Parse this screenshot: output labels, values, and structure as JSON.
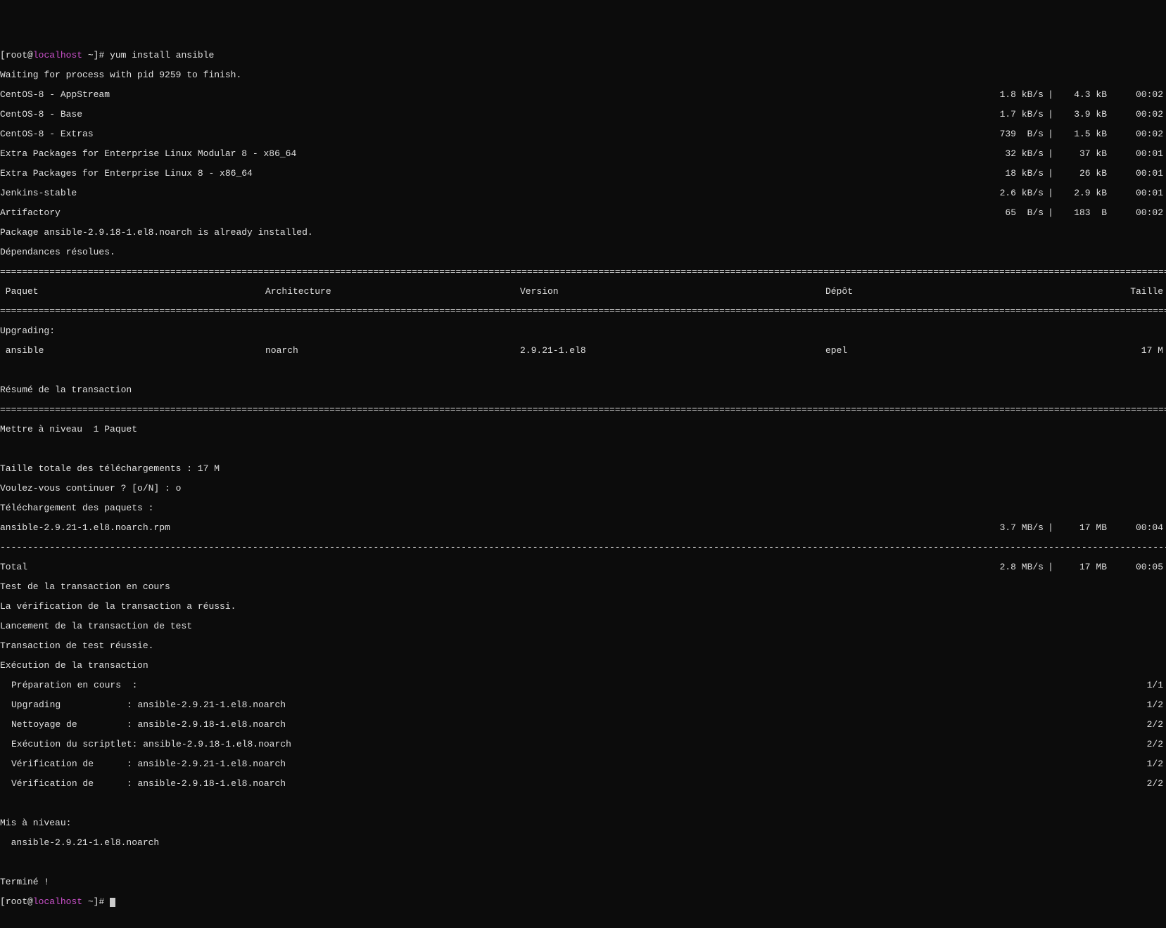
{
  "prompt": {
    "user": "root",
    "at": "@",
    "host": "localhost",
    "path": " ~",
    "suffix": "]# "
  },
  "command": "yum install ansible",
  "waiting": "Waiting for process with pid 9259 to finish.",
  "repos": [
    {
      "name": "CentOS-8 - AppStream",
      "speed": "1.8 kB/s",
      "size": "4.3 kB",
      "time": "00:02"
    },
    {
      "name": "CentOS-8 - Base",
      "speed": "1.7 kB/s",
      "size": "3.9 kB",
      "time": "00:02"
    },
    {
      "name": "CentOS-8 - Extras",
      "speed": "739  B/s",
      "size": "1.5 kB",
      "time": "00:02"
    },
    {
      "name": "Extra Packages for Enterprise Linux Modular 8 - x86_64",
      "speed": "32 kB/s",
      "size": "37 kB",
      "time": "00:01"
    },
    {
      "name": "Extra Packages for Enterprise Linux 8 - x86_64",
      "speed": "18 kB/s",
      "size": "26 kB",
      "time": "00:01"
    },
    {
      "name": "Jenkins-stable",
      "speed": "2.6 kB/s",
      "size": "2.9 kB",
      "time": "00:01"
    },
    {
      "name": "Artifactory",
      "speed": "65  B/s",
      "size": "183  B",
      "time": "00:02"
    }
  ],
  "already_installed": "Package ansible-2.9.18-1.el8.noarch is already installed.",
  "deps_resolved": "Dépendances résolues.",
  "headers": {
    "paquet": " Paquet",
    "arch": "Architecture",
    "version": "Version",
    "depot": "Dépôt",
    "taille": "Taille"
  },
  "upgrading_label": "Upgrading:",
  "package": {
    "name": " ansible",
    "arch": "noarch",
    "version": "2.9.21-1.el8",
    "depot": "epel",
    "taille": "17 M"
  },
  "summary_title": "Résumé de la transaction",
  "upgrade_count": "Mettre à niveau  1 Paquet",
  "total_dl": "Taille totale des téléchargements : 17 M",
  "continue_prompt": "Voulez-vous continuer ? [o/N] : o",
  "dl_label": "Téléchargement des paquets :",
  "dl_pkg": {
    "name": "ansible-2.9.21-1.el8.noarch.rpm",
    "speed": "3.7 MB/s",
    "size": "17 MB",
    "time": "00:04"
  },
  "total_line": {
    "label": "Total",
    "speed": "2.8 MB/s",
    "size": "17 MB",
    "time": "00:05"
  },
  "trans": {
    "test_running": "Test de la transaction en cours",
    "verify_ok": "La vérification de la transaction a réussi.",
    "launch_test": "Lancement de la transaction de test",
    "test_ok": "Transaction de test réussie.",
    "exec": "Exécution de la transaction"
  },
  "steps": [
    {
      "label": "Préparation en cours  :",
      "pkg": "",
      "prog": "1/1"
    },
    {
      "label": "Upgrading            :",
      "pkg": " ansible-2.9.21-1.el8.noarch",
      "prog": "1/2"
    },
    {
      "label": "Nettoyage de         :",
      "pkg": " ansible-2.9.18-1.el8.noarch",
      "prog": "2/2"
    },
    {
      "label": "Exécution du scriptlet:",
      "pkg": " ansible-2.9.18-1.el8.noarch",
      "prog": "2/2"
    },
    {
      "label": "Vérification de      :",
      "pkg": " ansible-2.9.21-1.el8.noarch",
      "prog": "1/2"
    },
    {
      "label": "Vérification de      :",
      "pkg": " ansible-2.9.18-1.el8.noarch",
      "prog": "2/2"
    }
  ],
  "upgraded_label": "Mis à niveau:",
  "upgraded_pkg": "  ansible-2.9.21-1.el8.noarch",
  "done": "Terminé !",
  "rule_eq": "======================================================================================================================================================================================================================================",
  "rule_dash": "--------------------------------------------------------------------------------------------------------------------------------------------------------------------------------------------------------------------------------------"
}
